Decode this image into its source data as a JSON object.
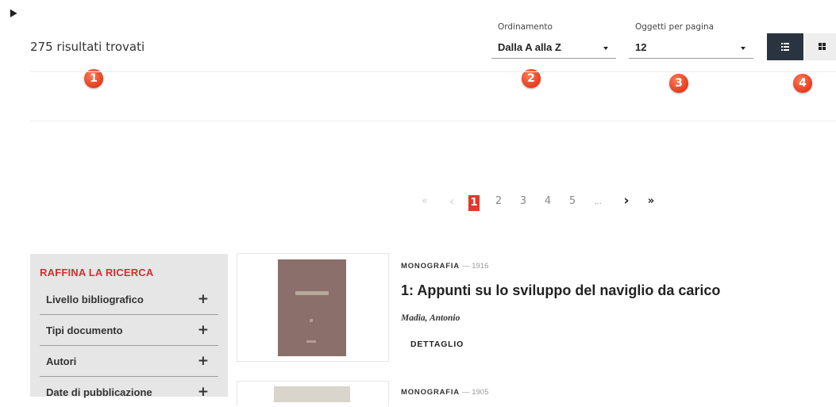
{
  "results": {
    "count_text": "275 risultati trovati"
  },
  "sort": {
    "label": "Ordinamento",
    "value": "Dalla A alla Z"
  },
  "per_page": {
    "label": "Oggetti per pagina",
    "value": "12"
  },
  "view_toggle": {
    "list_icon": "list-icon",
    "grid_icon": "grid-icon",
    "active": "list"
  },
  "callouts": [
    "1",
    "2",
    "3",
    "4"
  ],
  "pagination": {
    "first": "«",
    "prev": "‹",
    "pages": [
      "1",
      "2",
      "3",
      "4",
      "5"
    ],
    "current": "1",
    "ellipsis": "...",
    "next": "›",
    "last": "»"
  },
  "sidebar": {
    "title": "RAFFINA LA RICERCA",
    "facets": [
      {
        "label": "Livello bibliografico",
        "icon": "plus-icon"
      },
      {
        "label": "Tipi documento",
        "icon": "plus-icon"
      },
      {
        "label": "Autori",
        "icon": "plus-icon"
      },
      {
        "label": "Date di pubblicazione",
        "icon": "plus-icon"
      }
    ]
  },
  "results_list": [
    {
      "type": "MONOGRAFIA",
      "year": "— 1916",
      "title": "1: Appunti su lo sviluppo del naviglio da carico",
      "author": "Madia, Antonio",
      "detail_label": "DETTAGLIO"
    },
    {
      "type": "MONOGRAFIA",
      "year": "— 1905"
    }
  ],
  "colors": {
    "accent": "#e03a2a",
    "sidebar_title": "#d32f2f",
    "view_active": "#2a3340"
  }
}
